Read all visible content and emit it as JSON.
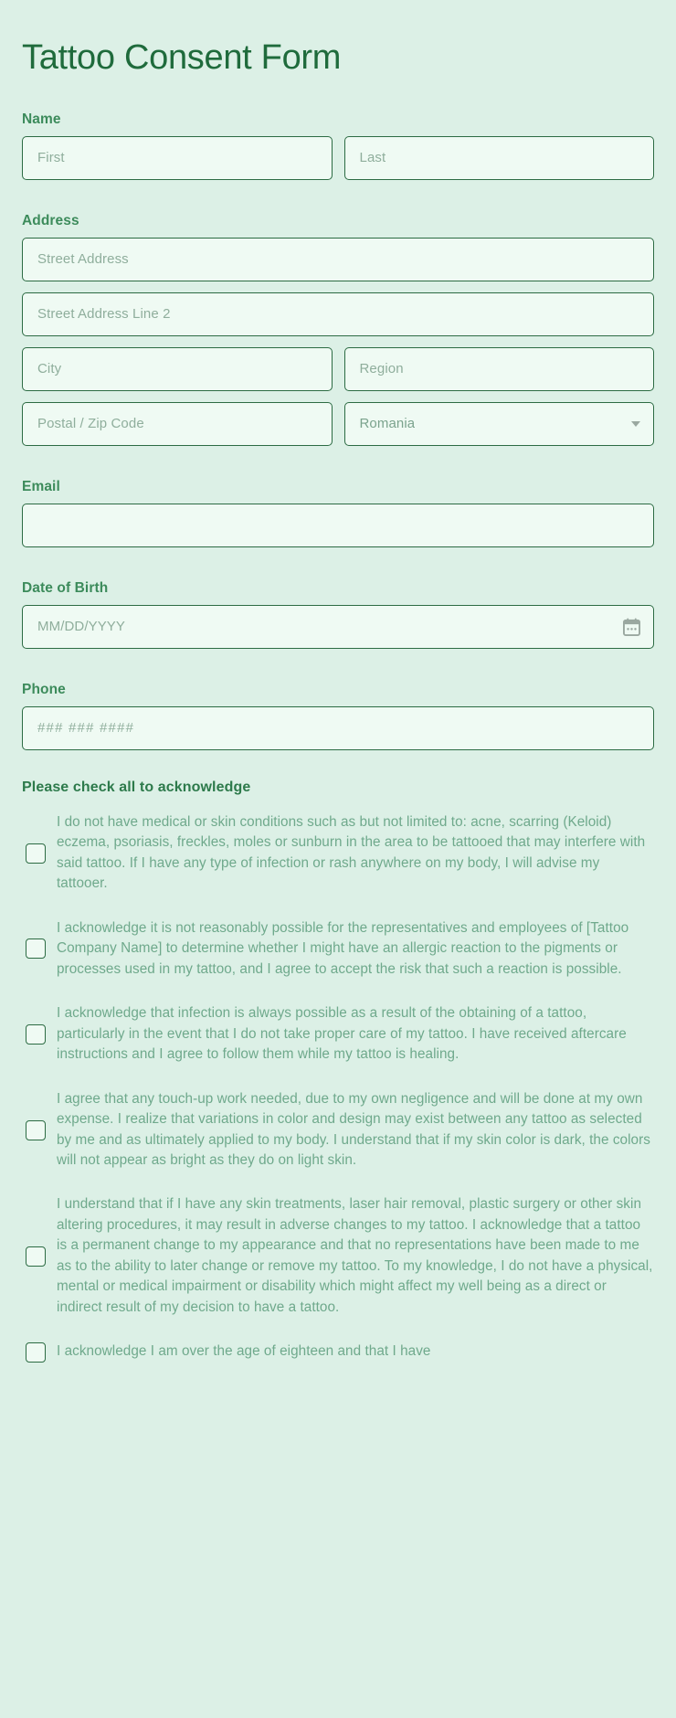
{
  "form": {
    "title": "Tattoo Consent Form"
  },
  "colors": {
    "page_background": "#dcf0e6",
    "title": "#1f6b3c",
    "label": "#3c8b5b",
    "input_background": "#effaf3",
    "input_border": "#2c6b43",
    "placeholder": "#8fae9c",
    "body_text": "#6fa98c"
  },
  "fields": {
    "name": {
      "label": "Name",
      "first_placeholder": "First",
      "last_placeholder": "Last",
      "first_value": "",
      "last_value": ""
    },
    "address": {
      "label": "Address",
      "street_placeholder": "Street Address",
      "street2_placeholder": "Street Address Line 2",
      "city_placeholder": "City",
      "region_placeholder": "Region",
      "postal_placeholder": "Postal / Zip Code",
      "country_value": "Romania",
      "street_value": "",
      "street2_value": "",
      "city_value": "",
      "region_value": "",
      "postal_value": ""
    },
    "email": {
      "label": "Email",
      "placeholder": "",
      "value": ""
    },
    "date_of_birth": {
      "label": "Date of Birth",
      "placeholder": "MM/DD/YYYY",
      "value": ""
    },
    "phone": {
      "label": "Phone",
      "placeholder": "### ### ####",
      "value": ""
    }
  },
  "acknowledge": {
    "heading": "Please check all to acknowledge",
    "items": [
      {
        "text": "I do not have medical or skin conditions such as but not limited to: acne, scarring (Keloid) eczema, psoriasis, freckles, moles or sunburn in the area to be tattooed that may interfere with said tattoo. If I have any type of infection or rash anywhere on my body, I will advise my tattooer.",
        "checked": false
      },
      {
        "text": "I acknowledge it is not reasonably possible for the representatives and employees of [Tattoo Company Name] to determine whether I might have an allergic reaction to the pigments or processes used in my tattoo, and I agree to accept the risk that such a reaction is possible.",
        "checked": false
      },
      {
        "text": "I acknowledge that infection is always possible as a result of the obtaining of a tattoo, particularly in the event that I do not take proper care of my tattoo. I have received aftercare instructions and I agree to follow them while my tattoo is healing.",
        "checked": false
      },
      {
        "text": "I agree that any touch-up work needed, due to my own negligence and will be done at my own expense. I realize that variations in color and design may exist between any tattoo as selected by me and as ultimately applied to my body. I understand that if my skin color is dark, the colors will not appear as bright as they do on light skin.",
        "checked": false
      },
      {
        "text": "I understand that if I have any skin treatments, laser hair removal, plastic surgery or other skin altering procedures, it may result in adverse changes to my tattoo. I acknowledge that a tattoo is a permanent change to my appearance and that no representations have been made to me as to the ability to later change or remove my tattoo. To my knowledge, I do not have a physical, mental or medical impairment or disability which might affect my well being as a direct or indirect result of my decision to have a tattoo.",
        "checked": false
      },
      {
        "text": "I acknowledge I am over the age of eighteen and that I have",
        "checked": false
      }
    ]
  },
  "icons": {
    "calendar": "calendar-icon",
    "dropdown_caret": "chevron-down-icon"
  }
}
